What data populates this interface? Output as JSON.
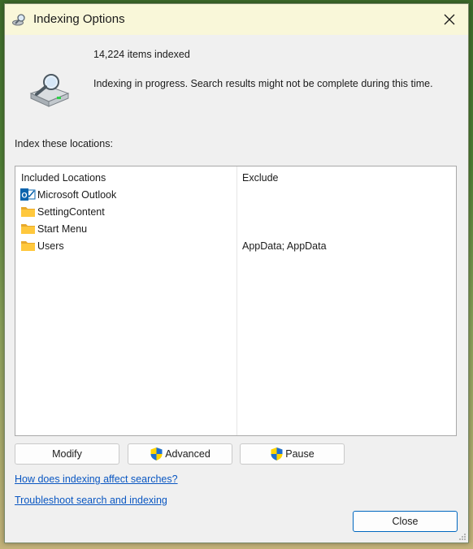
{
  "window": {
    "title": "Indexing Options",
    "items_indexed": "14,224 items indexed",
    "status": "Indexing in progress. Search results might not be complete during this time.",
    "locations_heading": "Index these locations:"
  },
  "table": {
    "columns": [
      "Included Locations",
      "Exclude"
    ],
    "rows": [
      {
        "name": "Microsoft Outlook",
        "exclude": "",
        "icon": "outlook-icon"
      },
      {
        "name": "SettingContent",
        "exclude": "",
        "icon": "folder-icon"
      },
      {
        "name": "Start Menu",
        "exclude": "",
        "icon": "folder-icon"
      },
      {
        "name": "Users",
        "exclude": "AppData; AppData",
        "icon": "folder-icon"
      }
    ]
  },
  "buttons": {
    "modify": "Modify",
    "advanced": "Advanced",
    "pause": "Pause",
    "close": "Close"
  },
  "links": {
    "affect": "How does indexing affect searches?",
    "troubleshoot": "Troubleshoot search and indexing"
  },
  "colors": {
    "titlebar": "#f9f7d9",
    "link": "#0a57c2",
    "close_border": "#0067c0"
  }
}
